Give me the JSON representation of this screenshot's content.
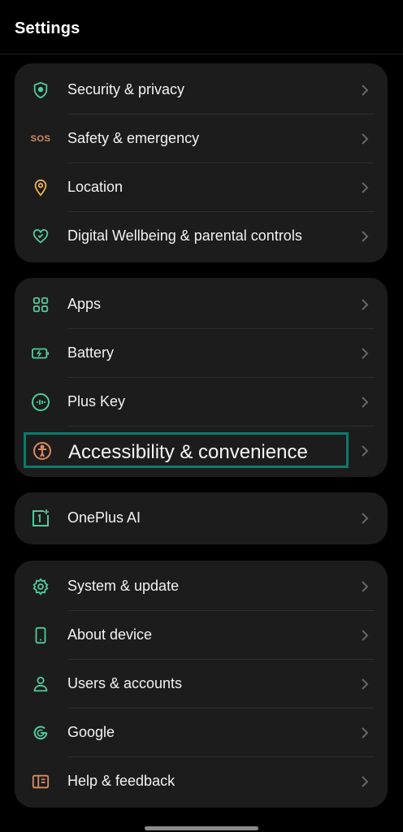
{
  "header": {
    "title": "Settings"
  },
  "groups": [
    {
      "items": [
        {
          "label": "Security & privacy",
          "icon": "shield-icon"
        },
        {
          "label": "Safety & emergency",
          "icon": "sos-icon",
          "icon_text": "SOS"
        },
        {
          "label": "Location",
          "icon": "location-pin-icon"
        },
        {
          "label": "Digital Wellbeing & parental controls",
          "icon": "wellbeing-icon"
        }
      ]
    },
    {
      "items": [
        {
          "label": "Apps",
          "icon": "apps-grid-icon"
        },
        {
          "label": "Battery",
          "icon": "battery-icon"
        },
        {
          "label": "Plus Key",
          "icon": "plus-key-icon"
        },
        {
          "label": "Accessibility & convenience",
          "icon": "accessibility-icon",
          "highlighted": true
        }
      ]
    },
    {
      "items": [
        {
          "label": "OnePlus AI",
          "icon": "oneplus-ai-icon"
        }
      ]
    },
    {
      "items": [
        {
          "label": "System & update",
          "icon": "gear-icon"
        },
        {
          "label": "About device",
          "icon": "phone-icon"
        },
        {
          "label": "Users & accounts",
          "icon": "user-icon"
        },
        {
          "label": "Google",
          "icon": "google-icon"
        },
        {
          "label": "Help & feedback",
          "icon": "help-book-icon"
        }
      ]
    }
  ],
  "colors": {
    "background": "#000000",
    "card": "#1c1c1c",
    "icon_green": "#4ecb9a",
    "icon_orange": "#d88a62",
    "icon_yellow": "#e8b24a",
    "highlight_border": "#0e7a6b"
  }
}
